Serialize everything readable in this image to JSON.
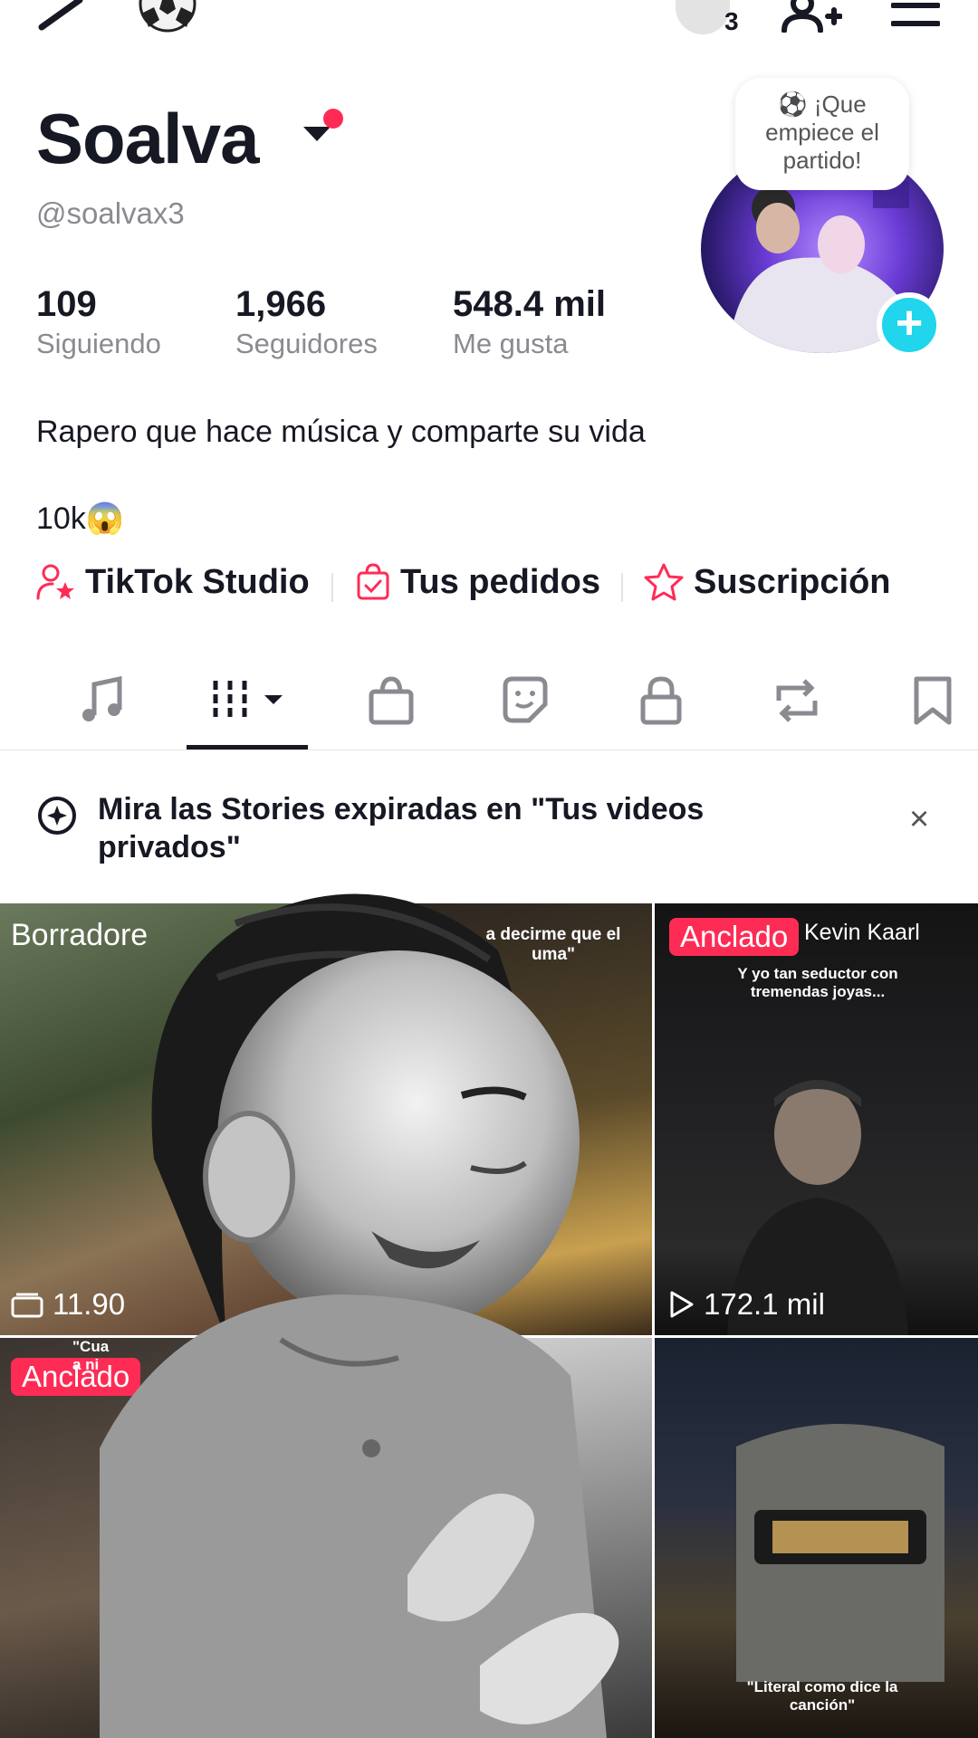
{
  "topbar": {
    "friends_count": "3"
  },
  "profile": {
    "display_name": "Soalva",
    "handle": "@soalvax3",
    "note_bubble": [
      "⚽ ¡Que",
      "empiece el",
      "partido!"
    ],
    "bio": "Rapero que hace música y comparte su vida",
    "bio_line2": "10k😱"
  },
  "stats": [
    {
      "value": "109",
      "label": "Siguiendo"
    },
    {
      "value": "1,966",
      "label": "Seguidores"
    },
    {
      "value": "548.4 mil",
      "label": "Me gusta"
    }
  ],
  "links": [
    {
      "label": "TikTok Studio",
      "icon": "person-star-icon"
    },
    {
      "label": "Tus pedidos",
      "icon": "shopping-bag-check-icon"
    },
    {
      "label": "Suscripción",
      "icon": "star-badge-icon"
    }
  ],
  "tabs": [
    "music-icon",
    "grid-icon",
    "shop-bag-icon",
    "sticker-icon",
    "lock-icon",
    "repost-icon",
    "bookmark-icon"
  ],
  "notice": {
    "text": "Mira las Stories expiradas en \"Tus videos privados\"",
    "close": "×"
  },
  "grid": {
    "drafts_label": "Borradore",
    "drafts_count": "11.90",
    "video2_caption": "a decirme que el\numa\"",
    "video3_pin": "Anclado",
    "video3_author": "Kevin Kaarl",
    "video3_caption": "Y yo tan seductor con\ntremendas joyas...",
    "video3_views": "172.1 mil",
    "video4_pin": "Anclado",
    "video4_caption": "\"Cua\na ni",
    "video6_caption": "\"Literal como dice la\ncanción\""
  },
  "colors": {
    "accent": "#fe2c55",
    "plus": "#20d5ec",
    "muted": "#8a8b91"
  }
}
